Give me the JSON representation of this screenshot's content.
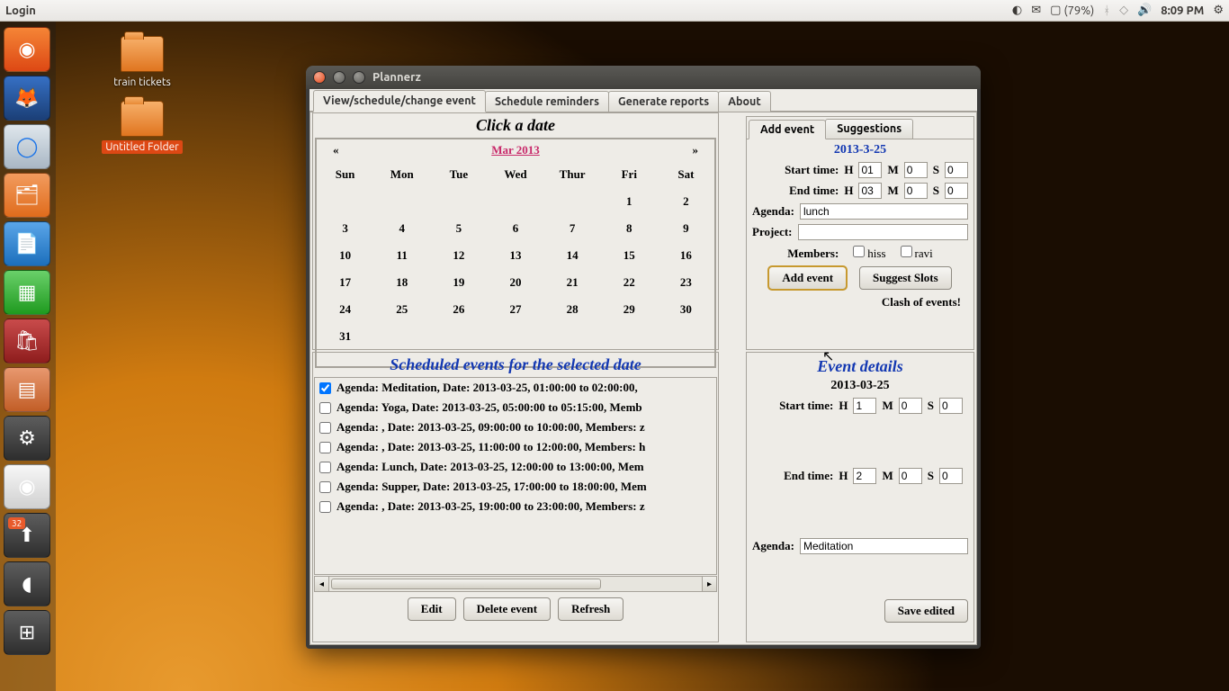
{
  "menubar": {
    "title": "Login",
    "battery": "(79%)",
    "time": "8:09 PM"
  },
  "desktop": {
    "icon1": "train tickets",
    "icon2": "Untitled Folder",
    "badge_count": "32"
  },
  "window": {
    "title": "Plannerz",
    "tabs": {
      "view": "View/schedule/change event",
      "reminders": "Schedule reminders",
      "reports": "Generate reports",
      "about": "About"
    }
  },
  "calendar": {
    "heading": "Click a date",
    "prev": "«",
    "next": "»",
    "month": "Mar 2013",
    "days": {
      "sun": "Sun",
      "mon": "Mon",
      "tue": "Tue",
      "wed": "Wed",
      "thu": "Thur",
      "fri": "Fri",
      "sat": "Sat"
    },
    "cells": [
      [
        "",
        "",
        "",
        "",
        "",
        "1",
        "2"
      ],
      [
        "3",
        "4",
        "5",
        "6",
        "7",
        "8",
        "9"
      ],
      [
        "10",
        "11",
        "12",
        "13",
        "14",
        "15",
        "16"
      ],
      [
        "17",
        "18",
        "19",
        "20",
        "21",
        "22",
        "23"
      ],
      [
        "24",
        "25",
        "26",
        "27",
        "28",
        "29",
        "30"
      ],
      [
        "31",
        "",
        "",
        "",
        "",
        "",
        ""
      ]
    ]
  },
  "addEvent": {
    "tabs": {
      "add": "Add event",
      "suggest": "Suggestions"
    },
    "date": "2013-3-25",
    "start_label": "Start time:",
    "end_label": "End time:",
    "H": "H",
    "M": "M",
    "S": "S",
    "start": {
      "h": "01",
      "m": "0",
      "s": "0"
    },
    "end": {
      "h": "03",
      "m": "0",
      "s": "0"
    },
    "agenda_label": "Agenda:",
    "agenda": "lunch",
    "project_label": "Project:",
    "project": "",
    "members_label": "Members:",
    "members": {
      "m1": "hiss",
      "m2": "ravi"
    },
    "btn_add": "Add event",
    "btn_suggest": "Suggest Slots",
    "clash": "Clash of events!"
  },
  "scheduled": {
    "heading": "Scheduled events for the selected date",
    "items": [
      "Agenda: Meditation, Date: 2013-03-25, 01:00:00 to 02:00:00, ",
      "Agenda: Yoga, Date: 2013-03-25, 05:00:00 to 05:15:00, Memb",
      "Agenda: , Date: 2013-03-25, 09:00:00 to 10:00:00, Members: z",
      "Agenda: , Date: 2013-03-25, 11:00:00 to 12:00:00, Members: h",
      "Agenda: Lunch, Date: 2013-03-25, 12:00:00 to 13:00:00, Mem",
      "Agenda: Supper, Date: 2013-03-25, 17:00:00 to 18:00:00, Mem",
      "Agenda: , Date: 2013-03-25, 19:00:00 to 23:00:00, Members: z"
    ],
    "btn_edit": "Edit",
    "btn_delete": "Delete event",
    "btn_refresh": "Refresh"
  },
  "details": {
    "heading": "Event details",
    "date": "2013-03-25",
    "start_label": "Start time:",
    "end_label": "End time:",
    "H": "H",
    "M": "M",
    "S": "S",
    "start": {
      "h": "1",
      "m": "0",
      "s": "0"
    },
    "end": {
      "h": "2",
      "m": "0",
      "s": "0"
    },
    "agenda_label": "Agenda:",
    "agenda": "Meditation",
    "btn_save": "Save edited"
  }
}
